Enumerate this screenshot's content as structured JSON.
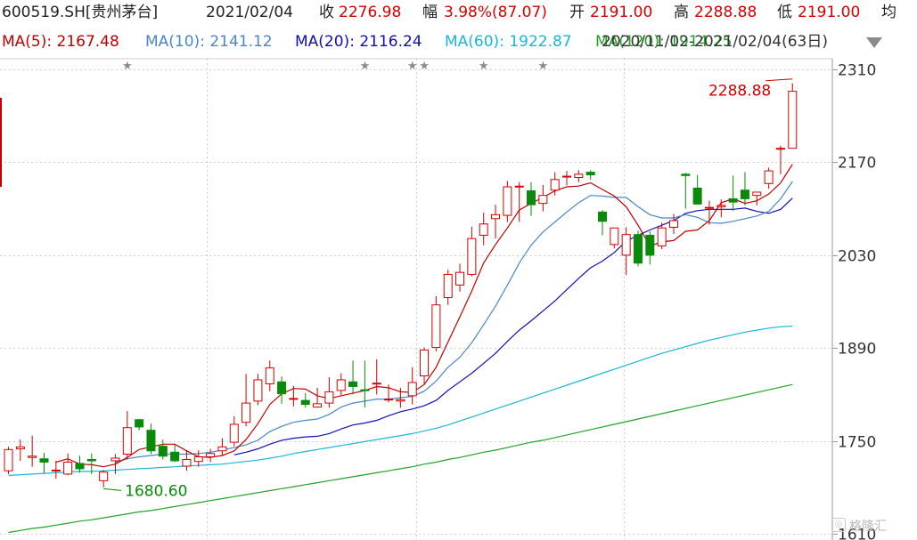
{
  "header": {
    "symbol": "600519.SH[贵州茅台]",
    "date": "2021/02/04",
    "close_label": "收",
    "close": "2276.98",
    "change_label": "幅",
    "change": "3.98%(87.07)",
    "open_label": "开",
    "open": "2191.00",
    "high_label": "高",
    "high": "2288.88",
    "low_label": "低",
    "low": "2191.00",
    "avg_label": "均"
  },
  "ma_legend": {
    "ma5": "MA(5): 2167.48",
    "ma10": "MA(10): 2141.12",
    "ma20": "MA(20): 2116.24",
    "ma60": "MA(60): 1922.87",
    "ma120": "MA(120): 1914.25",
    "range": "2020/11/02-2021/02/04(63日)"
  },
  "colors": {
    "up": "#d40000",
    "down": "#0a8a0a",
    "ma5": "#c00000",
    "ma10": "#4a86c8",
    "ma20": "#1010b0",
    "ma60": "#19b7d6",
    "ma120": "#23a12a",
    "grid": "#cfcfcf"
  },
  "watermark": "格隆汇",
  "chart_data": {
    "type": "candlestick",
    "ylim": [
      1610,
      2310
    ],
    "yticks": [
      "2310",
      "2170",
      "2030",
      "1890",
      "1750",
      "1610"
    ],
    "x": [
      "2020-11-02",
      "2020-11-03",
      "2020-11-04",
      "2020-11-05",
      "2020-11-06",
      "2020-11-09",
      "2020-11-10",
      "2020-11-11",
      "2020-11-12",
      "2020-11-13",
      "2020-11-16",
      "2020-11-17",
      "2020-11-18",
      "2020-11-19",
      "2020-11-20",
      "2020-11-23",
      "2020-11-24",
      "2020-11-25",
      "2020-11-26",
      "2020-11-27",
      "2020-11-30",
      "2020-12-01",
      "2020-12-02",
      "2020-12-03",
      "2020-12-04",
      "2020-12-07",
      "2020-12-08",
      "2020-12-09",
      "2020-12-10",
      "2020-12-11",
      "2020-12-14",
      "2020-12-15",
      "2020-12-16",
      "2020-12-17",
      "2020-12-18",
      "2020-12-21",
      "2020-12-22",
      "2020-12-23",
      "2020-12-24",
      "2020-12-25",
      "2020-12-28",
      "2020-12-29",
      "2020-12-30",
      "2020-12-31",
      "2021-01-04",
      "2021-01-05",
      "2021-01-06",
      "2021-01-07",
      "2021-01-08",
      "2021-01-11",
      "2021-01-12",
      "2021-01-13",
      "2021-01-14",
      "2021-01-15",
      "2021-01-18",
      "2021-01-19",
      "2021-01-20",
      "2021-01-21",
      "2021-01-22",
      "2021-01-25",
      "2021-01-26",
      "2021-01-27",
      "2021-01-28",
      "2021-02-01",
      "2021-02-02",
      "2021-02-03",
      "2021-02-04"
    ],
    "open": [
      1705,
      1738,
      1725,
      1723,
      1705,
      1700,
      1716,
      1722,
      1690,
      1720,
      1730,
      1782,
      1766,
      1742,
      1733,
      1712,
      1719,
      1726,
      1735,
      1748,
      1778,
      1810,
      1836,
      1839,
      1813,
      1811,
      1801,
      1807,
      1826,
      1839,
      1827,
      1836,
      1813,
      1810,
      1818,
      1848,
      1891,
      1966,
      1985,
      2001,
      2060,
      2085,
      2090,
      2134,
      2127,
      2108,
      2128,
      2149,
      2147,
      2155,
      2095,
      2046,
      2030,
      2061,
      2060,
      2044,
      2072,
      2152,
      2131,
      2102,
      2103,
      2115,
      2128,
      2120,
      2138,
      2191,
      2191
    ],
    "close": [
      1737,
      1741,
      1727,
      1718,
      1706,
      1718,
      1708,
      1720,
      1703,
      1724,
      1770,
      1771,
      1735,
      1727,
      1720,
      1722,
      1726,
      1731,
      1741,
      1775,
      1807,
      1842,
      1860,
      1821,
      1814,
      1805,
      1806,
      1824,
      1842,
      1832,
      1826,
      1837,
      1813,
      1812,
      1838,
      1887,
      1955,
      2001,
      2004,
      2055,
      2077,
      2091,
      2133,
      2134,
      2106,
      2120,
      2144,
      2149,
      2152,
      2151,
      2081,
      2071,
      2061,
      2018,
      2030,
      2071,
      2082,
      2150,
      2107,
      2102,
      2105,
      2110,
      2115,
      2125,
      2157,
      2191,
      2277
    ],
    "high": [
      1741,
      1752,
      1758,
      1732,
      1720,
      1731,
      1728,
      1731,
      1706,
      1730,
      1795,
      1783,
      1776,
      1752,
      1745,
      1736,
      1736,
      1738,
      1754,
      1787,
      1851,
      1851,
      1871,
      1847,
      1833,
      1822,
      1830,
      1846,
      1852,
      1871,
      1871,
      1873,
      1835,
      1830,
      1861,
      1891,
      1968,
      2008,
      2017,
      2073,
      2094,
      2106,
      2142,
      2140,
      2140,
      2136,
      2155,
      2157,
      2158,
      2158,
      2098,
      2053,
      2072,
      2067,
      2066,
      2079,
      2092,
      2154,
      2151,
      2112,
      2114,
      2150,
      2155,
      2125,
      2162,
      2195,
      2289
    ],
    "low": [
      1700,
      1720,
      1711,
      1701,
      1693,
      1698,
      1702,
      1700,
      1680,
      1700,
      1722,
      1766,
      1730,
      1722,
      1718,
      1705,
      1711,
      1718,
      1728,
      1742,
      1772,
      1804,
      1825,
      1806,
      1802,
      1800,
      1800,
      1800,
      1819,
      1820,
      1800,
      1820,
      1808,
      1800,
      1805,
      1835,
      1885,
      1955,
      1975,
      1998,
      2045,
      2055,
      2080,
      2080,
      2089,
      2096,
      2120,
      2135,
      2140,
      2144,
      2060,
      2040,
      2000,
      2013,
      2016,
      2039,
      2062,
      2100,
      2106,
      2076,
      2087,
      2097,
      2105,
      2105,
      2130,
      2152,
      2191
    ],
    "annotations": [
      {
        "text": "2288.88",
        "x_index": 66,
        "y": 2288.88,
        "color": "#d40000",
        "side": "left"
      },
      {
        "text": "1680.60",
        "x_index": 8,
        "y": 1680.6,
        "color": "#0a8a0a",
        "side": "right"
      }
    ],
    "event_markers_x_index": [
      10,
      30,
      34,
      35,
      40,
      45
    ],
    "series": [
      {
        "name": "MA(5)",
        "color": "#c00000",
        "values": [
          null,
          null,
          null,
          null,
          1718,
          1723,
          1715,
          1714,
          1711,
          1715,
          1725,
          1737,
          1741,
          1745,
          1745,
          1735,
          1726,
          1725,
          1728,
          1735,
          1752,
          1776,
          1805,
          1821,
          1829,
          1828,
          1818,
          1814,
          1818,
          1822,
          1826,
          1832,
          1830,
          1824,
          1823,
          1835,
          1861,
          1899,
          1937,
          1976,
          2018,
          2046,
          2071,
          2098,
          2108,
          2117,
          2127,
          2133,
          2134,
          2139,
          2129,
          2119,
          2103,
          2075,
          2044,
          2050,
          2052,
          2066,
          2068,
          2082,
          2109,
          2115,
          2108,
          2112,
          2122,
          2139,
          2167
        ]
      },
      {
        "name": "MA(10)",
        "color": "#4a86c8",
        "values": [
          null,
          null,
          null,
          null,
          null,
          null,
          null,
          null,
          null,
          1718,
          1723,
          1726,
          1728,
          1730,
          1730,
          1730,
          1731,
          1733,
          1736,
          1740,
          1744,
          1751,
          1764,
          1772,
          1778,
          1781,
          1783,
          1790,
          1801,
          1807,
          1810,
          1813,
          1813,
          1815,
          1817,
          1825,
          1840,
          1861,
          1876,
          1898,
          1925,
          1953,
          1985,
          2018,
          2045,
          2065,
          2080,
          2095,
          2109,
          2120,
          2119,
          2117,
          2117,
          2103,
          2091,
          2086,
          2086,
          2091,
          2087,
          2079,
          2078,
          2081,
          2085,
          2089,
          2096,
          2115,
          2141
        ]
      },
      {
        "name": "MA(20)",
        "color": "#1010b0",
        "values": [
          null,
          null,
          null,
          null,
          null,
          null,
          null,
          null,
          null,
          null,
          null,
          null,
          null,
          null,
          null,
          null,
          null,
          null,
          null,
          1729,
          1733,
          1738,
          1745,
          1751,
          1754,
          1756,
          1757,
          1761,
          1768,
          1774,
          1777,
          1781,
          1788,
          1794,
          1798,
          1803,
          1811,
          1826,
          1839,
          1852,
          1867,
          1882,
          1900,
          1917,
          1931,
          1946,
          1961,
          1978,
          1995,
          2011,
          2021,
          2034,
          2051,
          2060,
          2068,
          2075,
          2082,
          2093,
          2097,
          2099,
          2099,
          2099,
          2101,
          2096,
          2093,
          2099,
          2116
        ]
      },
      {
        "name": "MA(60)",
        "color": "#19b7d6",
        "values": [
          1698,
          1699,
          1700,
          1701,
          1702,
          1703,
          1704,
          1704,
          1705,
          1706,
          1707,
          1708,
          1709,
          1710,
          1711,
          1712,
          1713,
          1714,
          1715,
          1717,
          1719,
          1721,
          1724,
          1727,
          1731,
          1734,
          1737,
          1740,
          1743,
          1746,
          1749,
          1752,
          1755,
          1758,
          1761,
          1765,
          1769,
          1774,
          1780,
          1786,
          1792,
          1798,
          1804,
          1810,
          1816,
          1822,
          1828,
          1834,
          1840,
          1846,
          1852,
          1858,
          1864,
          1870,
          1876,
          1882,
          1887,
          1892,
          1897,
          1902,
          1906,
          1910,
          1914,
          1917,
          1920,
          1922,
          1923
        ]
      },
      {
        "name": "MA(120)",
        "color": "#23a12a",
        "values": [
          1612,
          1615,
          1618,
          1620,
          1623,
          1626,
          1629,
          1631,
          1634,
          1637,
          1640,
          1643,
          1645,
          1648,
          1651,
          1654,
          1657,
          1660,
          1663,
          1666,
          1669,
          1672,
          1675,
          1678,
          1681,
          1684,
          1687,
          1690,
          1693,
          1696,
          1699,
          1702,
          1705,
          1708,
          1711,
          1715,
          1718,
          1722,
          1725,
          1729,
          1733,
          1736,
          1740,
          1744,
          1748,
          1751,
          1755,
          1759,
          1763,
          1767,
          1771,
          1775,
          1779,
          1783,
          1787,
          1791,
          1795,
          1799,
          1803,
          1807,
          1811,
          1815,
          1819,
          1823,
          1827,
          1831,
          1835
        ]
      }
    ]
  }
}
